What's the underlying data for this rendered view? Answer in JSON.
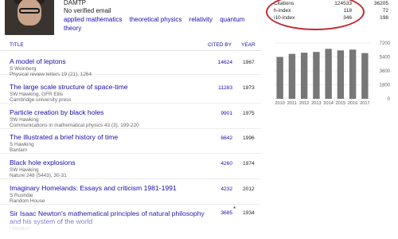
{
  "profile": {
    "affiliation": "DAMTP",
    "email": "No verified email",
    "interests": [
      "applied mathematics",
      "theoretical physics",
      "relativity",
      "quantum theory"
    ]
  },
  "stats": {
    "rows": [
      {
        "label": "Citations",
        "all": "124533",
        "since": "36205"
      },
      {
        "label": "h-index",
        "all": "118",
        "since": "72"
      },
      {
        "label": "i10-index",
        "all": "346",
        "since": "198"
      }
    ]
  },
  "chart_data": {
    "type": "bar",
    "categories": [
      "2010",
      "2011",
      "2012",
      "2013",
      "2014",
      "2015",
      "2016",
      "2017"
    ],
    "values": [
      5400,
      5800,
      5950,
      6050,
      6450,
      6250,
      6350,
      5900
    ],
    "ylim": [
      0,
      7200
    ],
    "yticks": [
      "7200",
      "5400",
      "3600",
      "1800",
      "0"
    ],
    "bar_color": "#777777",
    "title": "",
    "xlabel": "",
    "ylabel": ""
  },
  "table": {
    "headers": {
      "title": "TITLE",
      "cited_by": "CITED BY",
      "year": "YEAR"
    },
    "rows": [
      {
        "title": "A model of leptons",
        "authors": "S Weinberg",
        "venue": "Physical review letters 19 (21), 1264",
        "cited": "14624",
        "year": "1967"
      },
      {
        "title": "The large scale structure of space-time",
        "authors": "SW Hawking, GFR Ellis",
        "venue": "Cambridge university press",
        "cited": "11283",
        "year": "1973"
      },
      {
        "title": "Particle creation by black holes",
        "authors": "SW Hawking",
        "venue": "Communications in mathematical physics 43 (3), 199-220",
        "cited": "9901",
        "year": "1975"
      },
      {
        "title": "The illustrated a brief history of time",
        "authors": "S Hawking",
        "venue": "Bantam",
        "cited": "6642",
        "year": "1996"
      },
      {
        "title": "Black hole explosions",
        "authors": "SW Hawking",
        "venue": "Nature 248 (5443), 30-31",
        "cited": "4260",
        "year": "1974"
      },
      {
        "title": "Imaginary Homelands: Essays and criticism 1981-1991",
        "authors": "S Rushdie",
        "venue": "Random House",
        "cited": "4232",
        "year": "2012"
      },
      {
        "title": "Sir Isaac Newton's mathematical principles of natural philosophy and his system of the world",
        "authors": "I Newton",
        "venue": "",
        "cited": "3685",
        "year": "1934",
        "star": "*"
      }
    ]
  }
}
